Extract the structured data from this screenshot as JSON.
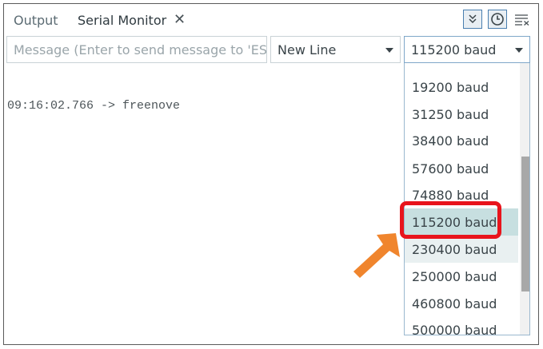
{
  "tabs": [
    {
      "label": "Output"
    },
    {
      "label": "Serial Monitor"
    }
  ],
  "toolbar": {
    "close_symbol": "✕",
    "autoscroll_icon": "double-chevron-down-icon",
    "timestamp_icon": "clock-icon",
    "clear_icon": "clear-output-icon"
  },
  "message_input": {
    "placeholder": "Message (Enter to send message to 'ES..."
  },
  "line_ending": {
    "selected": "New Line"
  },
  "baud_rate": {
    "selected": "115200 baud",
    "options": [
      "19200 baud",
      "31250 baud",
      "38400 baud",
      "57600 baud",
      "74880 baud",
      "115200 baud",
      "230400 baud",
      "250000 baud",
      "460800 baud",
      "500000 baud"
    ]
  },
  "output_log": {
    "lines": [
      "09:16:02.766 -> freenove"
    ]
  },
  "colors": {
    "highlight": "#e8141c",
    "arrow": "#f0852d",
    "selected_option_bg": "#c7dfe0",
    "hover_option_bg": "#e9f0f1"
  }
}
